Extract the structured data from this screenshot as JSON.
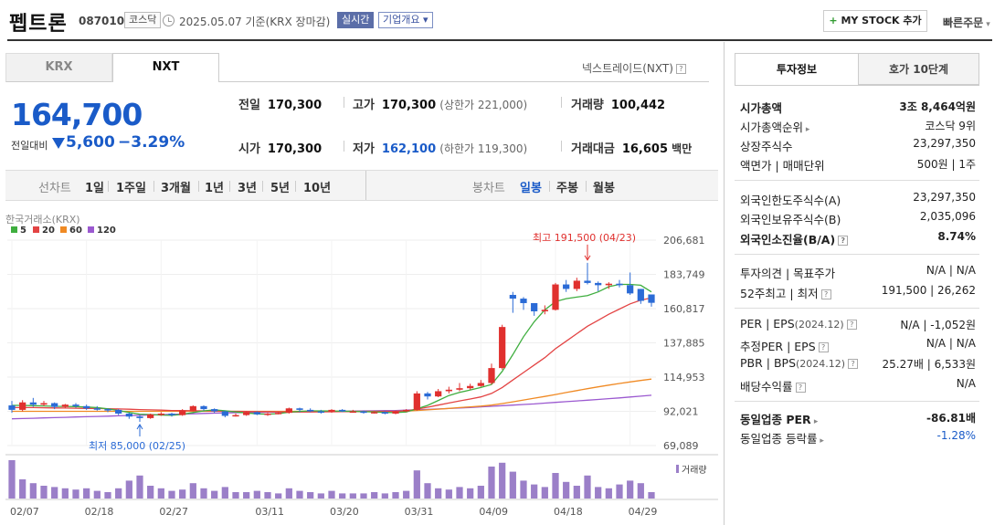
{
  "header": {
    "name": "펩트론",
    "code": "087010",
    "market": "코스닥",
    "date": "2025.05.07 기준(KRX 장마감)",
    "realtime": "실시간",
    "overview": "기업개요 ▾",
    "mystock": "MY STOCK 추가",
    "quick": "빠른주문"
  },
  "tabs": {
    "krx": "KRX",
    "nxt": "NXT",
    "nxt_link": "넥스트레이드(NXT)"
  },
  "quote": {
    "price": "164,700",
    "change_label": "전일대비",
    "change": "5,600",
    "rate": "−3.29%",
    "prev_label": "전일",
    "prev": "170,300",
    "high_label": "고가",
    "high": "170,300",
    "upper": "(상한가 221,000)",
    "volume_label": "거래량",
    "volume": "100,442",
    "open_label": "시가",
    "open": "170,300",
    "low_label": "저가",
    "low": "162,100",
    "lower": "(하한가 119,300)",
    "amount_label": "거래대금",
    "amount": "16,605",
    "amount_unit": "백만"
  },
  "controls": {
    "line": "선차트",
    "d1": "1일",
    "w1": "1주일",
    "m3": "3개월",
    "y1": "1년",
    "y3": "3년",
    "y5": "5년",
    "y10": "10년",
    "candle": "봉차트",
    "daily": "일봉",
    "weekly": "주봉",
    "monthly": "월봉"
  },
  "chart_data": {
    "type": "candlestick",
    "source_label": "한국거래소(KRX)",
    "legend": [
      {
        "name": "5",
        "color": "#3fae3f"
      },
      {
        "name": "20",
        "color": "#e34444"
      },
      {
        "name": "60",
        "color": "#f08a24"
      },
      {
        "name": "120",
        "color": "#9b59d0"
      }
    ],
    "y_ticks": [
      "206,681",
      "183,749",
      "160,817",
      "137,885",
      "114,953",
      "92,021",
      "69,089"
    ],
    "ylim": [
      69089,
      206681
    ],
    "x_labels": [
      {
        "label": "02/07",
        "index": 0
      },
      {
        "label": "02/18",
        "index": 7
      },
      {
        "label": "02/27",
        "index": 14
      },
      {
        "label": "03/11",
        "index": 23
      },
      {
        "label": "03/20",
        "index": 30
      },
      {
        "label": "03/31",
        "index": 37
      },
      {
        "label": "04/09",
        "index": 44
      },
      {
        "label": "04/18",
        "index": 51
      },
      {
        "label": "04/29",
        "index": 58
      }
    ],
    "high_annotation": "최고 191,500 (04/23)",
    "low_annotation": "최저 85,000 (02/25)",
    "high_index": 54,
    "low_index": 12,
    "volume_label": "거래량",
    "candles": [
      [
        96000,
        93000,
        99000,
        91000
      ],
      [
        93000,
        98000,
        99500,
        92000
      ],
      [
        98000,
        96500,
        101000,
        95000
      ],
      [
        96500,
        97500,
        99000,
        95500
      ],
      [
        97500,
        95000,
        98000,
        93500
      ],
      [
        95000,
        96500,
        97000,
        94000
      ],
      [
        96500,
        95500,
        97500,
        94500
      ],
      [
        95500,
        94000,
        96500,
        93000
      ],
      [
        94000,
        93500,
        95500,
        92500
      ],
      [
        93500,
        93000,
        94000,
        91500
      ],
      [
        93000,
        90500,
        93500,
        89500
      ],
      [
        90500,
        88500,
        91000,
        87000
      ],
      [
        88500,
        87500,
        89500,
        85000
      ],
      [
        87500,
        90000,
        90500,
        87000
      ],
      [
        90000,
        90500,
        91500,
        89000
      ],
      [
        90500,
        89500,
        91000,
        88500
      ],
      [
        89500,
        92500,
        93500,
        89000
      ],
      [
        92500,
        95500,
        96000,
        92000
      ],
      [
        95500,
        93500,
        96000,
        92500
      ],
      [
        93500,
        92000,
        94000,
        91000
      ],
      [
        92000,
        89000,
        92500,
        88000
      ],
      [
        89000,
        89500,
        90500,
        88500
      ],
      [
        89500,
        91500,
        92000,
        89000
      ],
      [
        91500,
        90000,
        92000,
        89500
      ],
      [
        90000,
        90500,
        91000,
        89000
      ],
      [
        90500,
        91000,
        91500,
        90000
      ],
      [
        91000,
        94000,
        94500,
        90500
      ],
      [
        94000,
        93000,
        94500,
        91500
      ],
      [
        93000,
        92000,
        94000,
        91500
      ],
      [
        92000,
        91500,
        93000,
        90500
      ],
      [
        91500,
        93000,
        93500,
        91000
      ],
      [
        93000,
        92000,
        93500,
        91500
      ],
      [
        92000,
        92000,
        93000,
        91500
      ],
      [
        92000,
        91000,
        92500,
        90500
      ],
      [
        91000,
        91500,
        92000,
        90500
      ],
      [
        91500,
        90500,
        92000,
        90000
      ],
      [
        90500,
        92000,
        92500,
        90000
      ],
      [
        92000,
        93000,
        93500,
        91500
      ],
      [
        93000,
        104000,
        105500,
        92500
      ],
      [
        104000,
        102000,
        105000,
        100000
      ],
      [
        102000,
        105500,
        107000,
        101500
      ],
      [
        105500,
        106500,
        108500,
        104000
      ],
      [
        106500,
        107500,
        111000,
        105500
      ],
      [
        107500,
        109000,
        110500,
        106500
      ],
      [
        109000,
        111000,
        113000,
        108500
      ],
      [
        111000,
        121000,
        124000,
        110000
      ],
      [
        121000,
        148500,
        150000,
        120000
      ],
      [
        170000,
        167500,
        172000,
        158000
      ],
      [
        167500,
        164500,
        168500,
        160000
      ],
      [
        164500,
        159000,
        164500,
        156000
      ],
      [
        159000,
        160000,
        163000,
        157000
      ],
      [
        160000,
        177000,
        178000,
        159500
      ],
      [
        177000,
        174000,
        180000,
        172000
      ],
      [
        174000,
        179500,
        181500,
        172500
      ],
      [
        179500,
        178000,
        191500,
        177000
      ],
      [
        178000,
        176500,
        179000,
        172500
      ],
      [
        176500,
        177500,
        178500,
        174000
      ],
      [
        177500,
        176500,
        180000,
        175000
      ],
      [
        176500,
        171000,
        185000,
        170000
      ],
      [
        174000,
        166000,
        174000,
        164000
      ],
      [
        170300,
        164700,
        170300,
        162100
      ]
    ],
    "volume": [
      30,
      15,
      12,
      10,
      9,
      8,
      7,
      8,
      6,
      5,
      8,
      14,
      18,
      10,
      8,
      6,
      7,
      12,
      8,
      6,
      9,
      5,
      5,
      6,
      5,
      4,
      8,
      6,
      5,
      4,
      6,
      4,
      4,
      4,
      5,
      4,
      5,
      6,
      22,
      12,
      8,
      7,
      9,
      8,
      10,
      25,
      28,
      21,
      14,
      11,
      9,
      20,
      13,
      10,
      18,
      9,
      8,
      11,
      14,
      12,
      5
    ],
    "ma5": [
      96000,
      96000,
      95800,
      95600,
      95400,
      95300,
      95200,
      94900,
      94500,
      93700,
      92600,
      91300,
      90100,
      89900,
      89500,
      89300,
      90000,
      91200,
      92300,
      93000,
      92400,
      91600,
      91000,
      90300,
      90100,
      90500,
      91400,
      92000,
      92300,
      92300,
      92200,
      92100,
      92000,
      91800,
      91600,
      91300,
      91200,
      91600,
      93700,
      96000,
      99300,
      102600,
      104700,
      106300,
      108000,
      110000,
      118800,
      130000,
      142000,
      152000,
      160000,
      165500,
      167500,
      168500,
      169500,
      172000,
      175500,
      177000,
      177000,
      176500,
      172000
    ],
    "ma20": [
      94500,
      94500,
      94500,
      94400,
      94300,
      94200,
      94100,
      94000,
      93900,
      93800,
      93600,
      93400,
      93200,
      93000,
      92800,
      92600,
      92500,
      92400,
      92300,
      92200,
      92100,
      92000,
      91900,
      91800,
      91700,
      91650,
      91600,
      91600,
      91600,
      91650,
      91700,
      91750,
      91800,
      91850,
      91900,
      91950,
      92000,
      92300,
      93500,
      94800,
      96200,
      97600,
      99000,
      100300,
      101700,
      104000,
      108000,
      113000,
      118000,
      123000,
      128000,
      134000,
      139000,
      144000,
      149000,
      153000,
      157000,
      160500,
      164000,
      166500,
      168000
    ],
    "ma60": [
      92000,
      92000,
      92000,
      92000,
      92000,
      92000,
      92000,
      92000,
      92000,
      92000,
      92000,
      92000,
      92000,
      92000,
      92000,
      92000,
      92000,
      92000,
      92000,
      92000,
      92000,
      92000,
      92000,
      92000,
      92000,
      92000,
      92000,
      92000,
      92000,
      92000,
      92000,
      92000,
      92000,
      92000,
      92000,
      92000,
      92000,
      92200,
      92600,
      93000,
      93500,
      94000,
      94500,
      95000,
      95500,
      96200,
      97200,
      98400,
      99600,
      100800,
      102000,
      103300,
      104600,
      105900,
      107200,
      108400,
      109600,
      110700,
      111700,
      112700,
      113600
    ],
    "ma120": [
      87000,
      87200,
      87400,
      87600,
      87800,
      88000,
      88200,
      88400,
      88600,
      88800,
      89000,
      89200,
      89400,
      89600,
      89800,
      90000,
      90200,
      90400,
      90600,
      90800,
      91000,
      91100,
      91200,
      91300,
      91400,
      91500,
      91600,
      91700,
      91800,
      91900,
      92000,
      92100,
      92200,
      92300,
      92400,
      92500,
      92600,
      92800,
      93000,
      93300,
      93600,
      93900,
      94200,
      94600,
      95000,
      95400,
      95800,
      96200,
      96600,
      97000,
      97500,
      98000,
      98500,
      99000,
      99500,
      100000,
      100500,
      101000,
      101600,
      102200,
      102800
    ]
  },
  "invest": {
    "tab1": "투자정보",
    "tab2": "호가 10단계",
    "cap_label": "시가총액",
    "cap": "3조 8,464억원",
    "rank_label": "시가총액순위",
    "rank": "코스닥 9위",
    "shares_label": "상장주식수",
    "shares": "23,297,350",
    "face_label": "액면가 | 매매단위",
    "face": "500원 | 1주",
    "fl_label": "외국인한도주식수(A)",
    "fl": "23,297,350",
    "fh_label": "외국인보유주식수(B)",
    "fh": "2,035,096",
    "fr_label": "외국인소진율(B/A)",
    "fr": "8.74%",
    "op_label": "투자의견 | 목표주가",
    "op": "N/A | N/A",
    "w52_label": "52주최고 | 최저",
    "w52": "191,500 | 26,262",
    "per_label": "PER | EPS",
    "per_period": "(2024.12)",
    "per": "N/A | -1,052원",
    "eper_label": "추정PER | EPS",
    "eper": "N/A | N/A",
    "pbr_label": "PBR | BPS",
    "pbr_period": "(2024.12)",
    "pbr": "25.27배 | 6,533원",
    "div_label": "배당수익률",
    "div": "N/A",
    "sper_label": "동일업종 PER",
    "sper": "-86.81배",
    "srate_label": "동일업종 등락률",
    "srate": "-1.28%"
  }
}
